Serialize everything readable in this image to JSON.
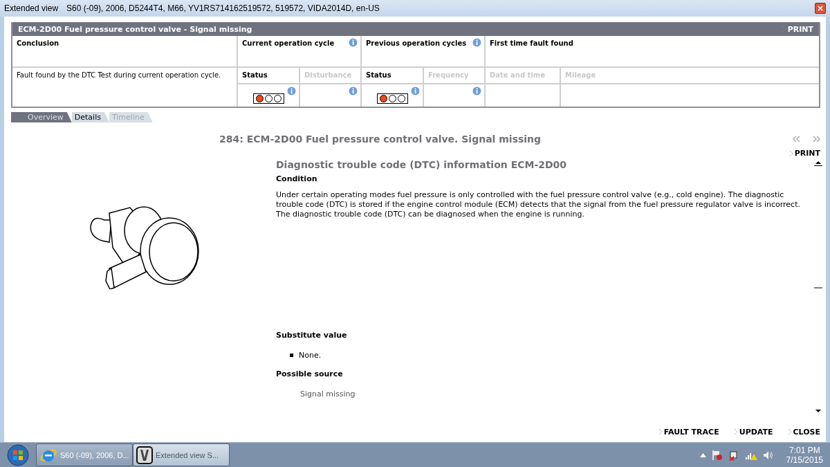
{
  "window": {
    "title": "Extended view",
    "subtitle": "S60 (-09), 2006, D5244T4, M66, YV1RS714162519572, 519572, VIDA2014D, en-US"
  },
  "fault_panel": {
    "title": "ECM-2D00 Fuel pressure control valve - Signal missing",
    "print": "PRINT",
    "conclusion": {
      "heading": "Conclusion",
      "text": "Fault found by the DTC Test during current operation cycle."
    },
    "current_cycle": {
      "heading": "Current operation cycle",
      "columns": [
        {
          "label": "Status",
          "disabled": false
        },
        {
          "label": "Disturbance",
          "disabled": true
        }
      ],
      "lights": [
        {
          "on": true
        },
        {
          "on": false
        },
        {
          "on": false
        }
      ]
    },
    "previous_cycles": {
      "heading": "Previous operation cycles",
      "columns": [
        {
          "label": "Status",
          "disabled": false
        },
        {
          "label": "Frequency",
          "disabled": true
        }
      ],
      "lights": [
        {
          "on": true
        },
        {
          "on": false
        },
        {
          "on": false
        }
      ]
    },
    "first_found": {
      "heading": "First time fault found",
      "columns": [
        {
          "label": "Date and time",
          "disabled": true
        },
        {
          "label": "Mileage",
          "disabled": true
        }
      ]
    }
  },
  "tabs": [
    {
      "label": "Overview",
      "selected": false,
      "disabled": false
    },
    {
      "label": "Details",
      "selected": true,
      "disabled": false
    },
    {
      "label": "Timeline",
      "selected": false,
      "disabled": true
    }
  ],
  "document": {
    "title": "284: ECM-2D00 Fuel pressure control valve. Signal missing",
    "print": "PRINT",
    "heading": "Diagnostic trouble code (DTC) information ECM-2D00",
    "condition_heading": "Condition",
    "condition_paragraphs": [
      "Under certain operating modes fuel pressure is only controlled with the fuel pressure control valve (e.g., cold engine). The diagnostic trouble code (DTC) is stored if the engine control module (ECM) detects that the signal from the fuel pressure regulator valve is incorrect.",
      "The diagnostic trouble code (DTC) can be diagnosed when the engine is running."
    ],
    "substitute_heading": "Substitute value",
    "substitute_items": [
      "None."
    ],
    "source_heading": "Possible source",
    "source_items": [
      "Signal missing"
    ]
  },
  "footer_buttons": [
    "FAULT TRACE",
    "UPDATE",
    "CLOSE"
  ],
  "taskbar": {
    "tasks": [
      {
        "label": "S60 (-09), 2006, D...",
        "kind": "browser",
        "selected": false
      },
      {
        "label": "Extended view   S...",
        "kind": "vida",
        "selected": true
      }
    ],
    "time": "7:01 PM",
    "date": "7/15/2015"
  }
}
